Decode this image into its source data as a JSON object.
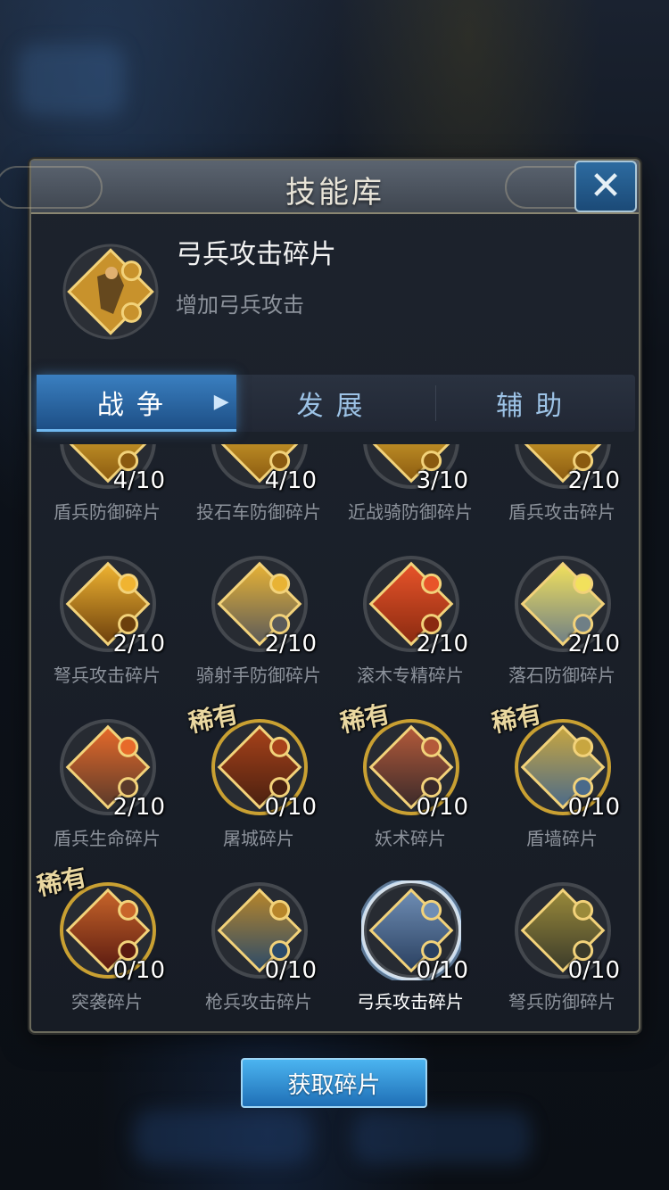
{
  "dialog": {
    "title": "技能库",
    "close_icon": "close-icon"
  },
  "selected": {
    "name": "弓兵攻击碎片",
    "description": "增加弓兵攻击"
  },
  "tabs": [
    {
      "label": "战争",
      "active": true
    },
    {
      "label": "发展",
      "active": false
    },
    {
      "label": "辅助",
      "active": false
    }
  ],
  "rare_tag": "稀有",
  "items": [
    {
      "label": "盾兵防御碎片",
      "count": "4/10",
      "colors": [
        "#f3c23a",
        "#8a5a10"
      ]
    },
    {
      "label": "投石车防御碎片",
      "count": "4/10",
      "colors": [
        "#f3c23a",
        "#8a5a10"
      ]
    },
    {
      "label": "近战骑防御碎片",
      "count": "3/10",
      "colors": [
        "#f3c23a",
        "#8a5a10"
      ]
    },
    {
      "label": "盾兵攻击碎片",
      "count": "2/10",
      "colors": [
        "#f3c23a",
        "#8a5a10"
      ]
    },
    {
      "label": "弩兵攻击碎片",
      "count": "2/10",
      "colors": [
        "#f0b431",
        "#6c3f0c"
      ]
    },
    {
      "label": "骑射手防御碎片",
      "count": "2/10",
      "colors": [
        "#e8b335",
        "#5a5a5a"
      ]
    },
    {
      "label": "滚木专精碎片",
      "count": "2/10",
      "colors": [
        "#e8542a",
        "#8a2a10"
      ]
    },
    {
      "label": "落石防御碎片",
      "count": "2/10",
      "colors": [
        "#f2e15c",
        "#6f7f86"
      ]
    },
    {
      "label": "盾兵生命碎片",
      "count": "2/10",
      "colors": [
        "#e76a2a",
        "#5a3a2a"
      ]
    },
    {
      "label": "屠城碎片",
      "count": "0/10",
      "colors": [
        "#a8421a",
        "#4a2010"
      ],
      "rare": true
    },
    {
      "label": "妖术碎片",
      "count": "0/10",
      "colors": [
        "#b45a3a",
        "#3a2a2a"
      ],
      "rare": true
    },
    {
      "label": "盾墙碎片",
      "count": "0/10",
      "colors": [
        "#c8a640",
        "#4a6a8a"
      ],
      "rare": true
    },
    {
      "label": "突袭碎片",
      "count": "0/10",
      "colors": [
        "#c8652a",
        "#5a1a10"
      ],
      "rare": true
    },
    {
      "label": "枪兵攻击碎片",
      "count": "0/10",
      "colors": [
        "#b8862a",
        "#2a4a6a"
      ]
    },
    {
      "label": "弓兵攻击碎片",
      "count": "0/10",
      "colors": [
        "#6f8eb5",
        "#2a4060"
      ],
      "selected": true
    },
    {
      "label": "弩兵防御碎片",
      "count": "0/10",
      "colors": [
        "#9a8a3a",
        "#3a3a2a"
      ]
    }
  ],
  "get_button": "获取碎片"
}
